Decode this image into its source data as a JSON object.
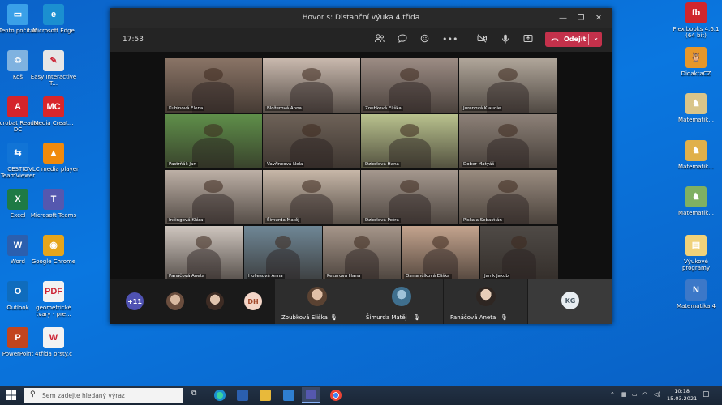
{
  "desktop": {
    "left_icons": [
      {
        "label": "Tento počítač",
        "color": "#3aa0e8",
        "glyph": "▭",
        "icon": "computer-icon"
      },
      {
        "label": "Microsoft Edge",
        "color": "#1b8fd0",
        "glyph": "e",
        "icon": "edge-icon"
      },
      {
        "label": "Koš",
        "color": "#7fb2e0",
        "glyph": "♲",
        "icon": "recycle-bin-icon"
      },
      {
        "label": "Easy Interactive T...",
        "color": "#e6e6e6",
        "glyph": "✎",
        "icon": "easy-interactive-icon"
      },
      {
        "label": "Acrobat Reader DC",
        "color": "#d4242b",
        "glyph": "A",
        "icon": "acrobat-icon"
      },
      {
        "label": "Media Creat...",
        "color": "#d8262b",
        "glyph": "MC",
        "icon": "media-creation-icon"
      },
      {
        "label": "CESTIO TeamViewer",
        "color": "#1174d6",
        "glyph": "⇆",
        "icon": "teamviewer-icon"
      },
      {
        "label": "VLC media player",
        "color": "#f08a0c",
        "glyph": "▲",
        "icon": "vlc-icon"
      },
      {
        "label": "Excel",
        "color": "#1e7a45",
        "glyph": "X",
        "icon": "excel-icon"
      },
      {
        "label": "Microsoft Teams",
        "color": "#5558af",
        "glyph": "T",
        "icon": "teams-icon"
      },
      {
        "label": "Word",
        "color": "#2b5fae",
        "glyph": "W",
        "icon": "word-icon"
      },
      {
        "label": "Google Chrome",
        "color": "#e5a51b",
        "glyph": "◉",
        "icon": "chrome-icon"
      },
      {
        "label": "Outlook",
        "color": "#0f6cbd",
        "glyph": "O",
        "icon": "outlook-icon"
      },
      {
        "label": "geometrické tvary - pre...",
        "color": "#f2f2f2",
        "glyph": "PDF",
        "icon": "pdf-file-icon"
      },
      {
        "label": "PowerPoint",
        "color": "#c2451e",
        "glyph": "P",
        "icon": "powerpoint-icon"
      },
      {
        "label": "4třída prsty.c",
        "color": "#f2f2f2",
        "glyph": "W",
        "icon": "word-file-icon"
      }
    ],
    "right_icons": [
      {
        "label": "Flexibooks 4.6.1 (64 bit)",
        "color": "#d0262d",
        "glyph": "fb",
        "icon": "flexibooks-icon"
      },
      {
        "label": "DidaktaCZ",
        "color": "#e7972a",
        "glyph": "🦉",
        "icon": "didakta-icon"
      },
      {
        "label": "Matematik...",
        "color": "#d9c58a",
        "glyph": "♞",
        "icon": "matematika-icon-1"
      },
      {
        "label": "Matematik...",
        "color": "#e0b04a",
        "glyph": "♞",
        "icon": "matematika-icon-2"
      },
      {
        "label": "Matematik...",
        "color": "#7fb062",
        "glyph": "♞",
        "icon": "matematika-icon-3"
      },
      {
        "label": "Výukové programy",
        "color": "#f0d27a",
        "glyph": "▤",
        "icon": "folder-icon"
      },
      {
        "label": "Matematika 4",
        "color": "#3c78c8",
        "glyph": "N",
        "icon": "matematika4-icon"
      }
    ]
  },
  "window": {
    "title": "Hovor s: Distanční výuka 4.třída",
    "minimize": "—",
    "maximize": "❐",
    "close": "✕"
  },
  "toolbar": {
    "time": "17:53",
    "leave_label": "Odejít"
  },
  "video_tiles": [
    {
      "name": "Kubinová Elena",
      "bg": "#8a7466"
    },
    {
      "name": "Bložerová Anna",
      "bg": "#c9b9ae"
    },
    {
      "name": "Zoubková Eliška",
      "bg": "#9c8c84"
    },
    {
      "name": "Jurenová Klaudie",
      "bg": "#b0a69a"
    },
    {
      "name": "Pastrňák Jan",
      "bg": "#5f8f4a"
    },
    {
      "name": "Vavřincová Nela",
      "bg": "#6e6258"
    },
    {
      "name": "Dzierlová Hana",
      "bg": "#b9c28e"
    },
    {
      "name": "Dober Matyáš",
      "bg": "#8d8178"
    },
    {
      "name": "Inčingová Klára",
      "bg": "#bdb0a6"
    },
    {
      "name": "Šimurda Matěj",
      "bg": "#c7b7a8"
    },
    {
      "name": "Dzierlová Petra",
      "bg": "#a5988e"
    },
    {
      "name": "Piskala Sebastián",
      "bg": "#9a8c80"
    },
    {
      "name": "Panáčová Aneta",
      "bg": "#cfc6bf"
    },
    {
      "name": "Hollesová Anna",
      "bg": "#6f8796"
    },
    {
      "name": "Pekarová Hana",
      "bg": "#a6968a"
    },
    {
      "name": "Osmančíková Eliška",
      "bg": "#c4a48e"
    },
    {
      "name": "Janík Jakub",
      "bg": "#4f4a46"
    }
  ],
  "strip": {
    "more_count": "+11",
    "dh_initials": "DH",
    "kg_initials": "KG",
    "tiles": [
      {
        "name": "Zoubková Eliška"
      },
      {
        "name": "Šimurda Matěj"
      },
      {
        "name": "Panáčová Aneta"
      }
    ]
  },
  "taskbar": {
    "search_placeholder": "Sem zadejte hledaný výraz",
    "time": "10:18",
    "date": "15.03.2021"
  }
}
